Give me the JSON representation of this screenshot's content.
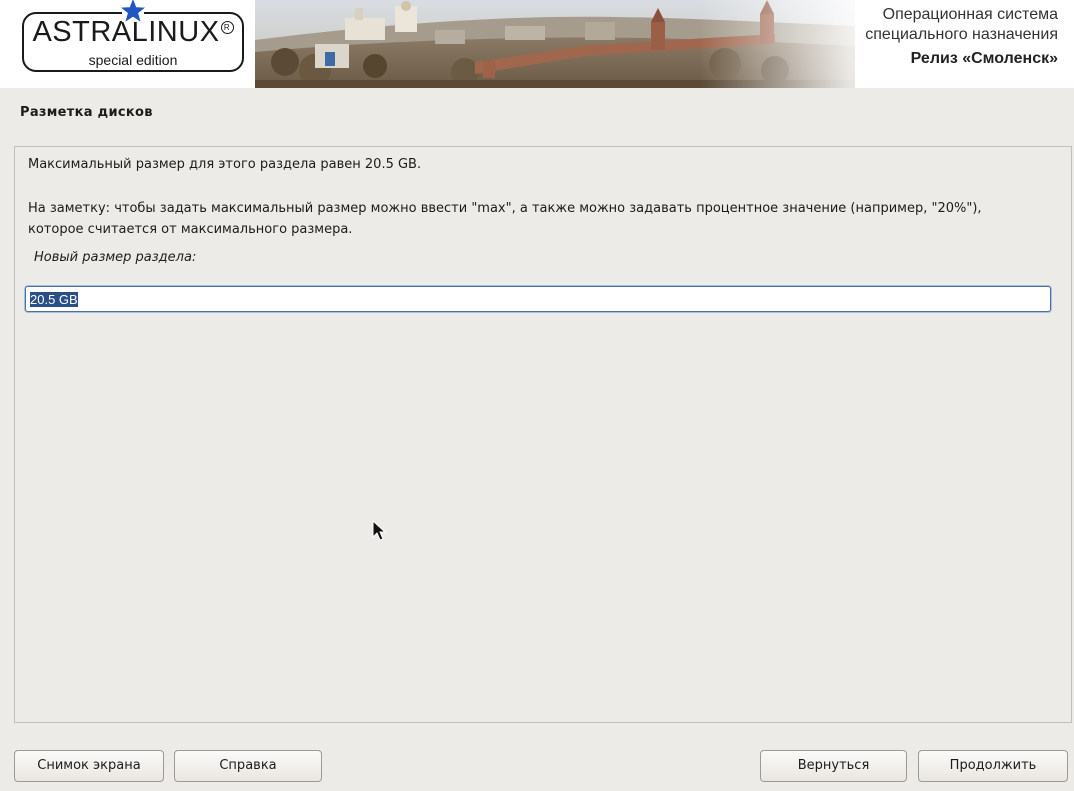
{
  "banner": {
    "logo_word": "ASTRALINUX",
    "logo_registered": "R",
    "logo_sub": "special edition",
    "os_line1": "Операционная система",
    "os_line2": "специального назначения",
    "release": "Релиз «Смоленск»"
  },
  "page": {
    "title": "Разметка дисков"
  },
  "content": {
    "max_size_text": "Максимальный размер для этого раздела равен 20.5 GB.",
    "note_text": "На заметку: чтобы задать максимальный размер можно ввести \"max\", а также можно задавать процентное значение (например, \"20%\"), которое считается от максимального размера.",
    "field_label": "Новый размер раздела:",
    "size_value": "20.5 GB"
  },
  "buttons": {
    "screenshot": "Снимок экрана",
    "help": "Справка",
    "back": "Вернуться",
    "continue": "Продолжить"
  },
  "icons": {
    "star": "star-icon",
    "cursor": "mouse-cursor-icon"
  },
  "colors": {
    "star": "#1f56c4",
    "selection": "#2a4f86",
    "input_border": "#4a6fa0"
  }
}
